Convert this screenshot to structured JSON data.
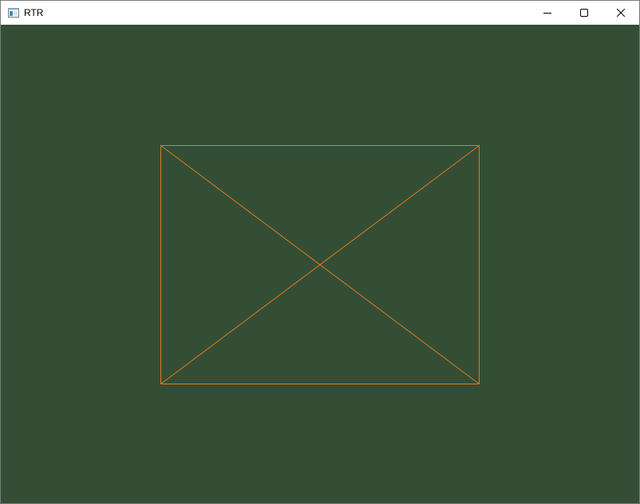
{
  "window": {
    "title": "RTR",
    "buttons": {
      "minimize": "minimize",
      "maximize": "maximize",
      "close": "close"
    }
  },
  "canvas": {
    "background_color": "#344e35",
    "stroke_color": "#e07a1e",
    "shape": "rectangle with both diagonals"
  }
}
